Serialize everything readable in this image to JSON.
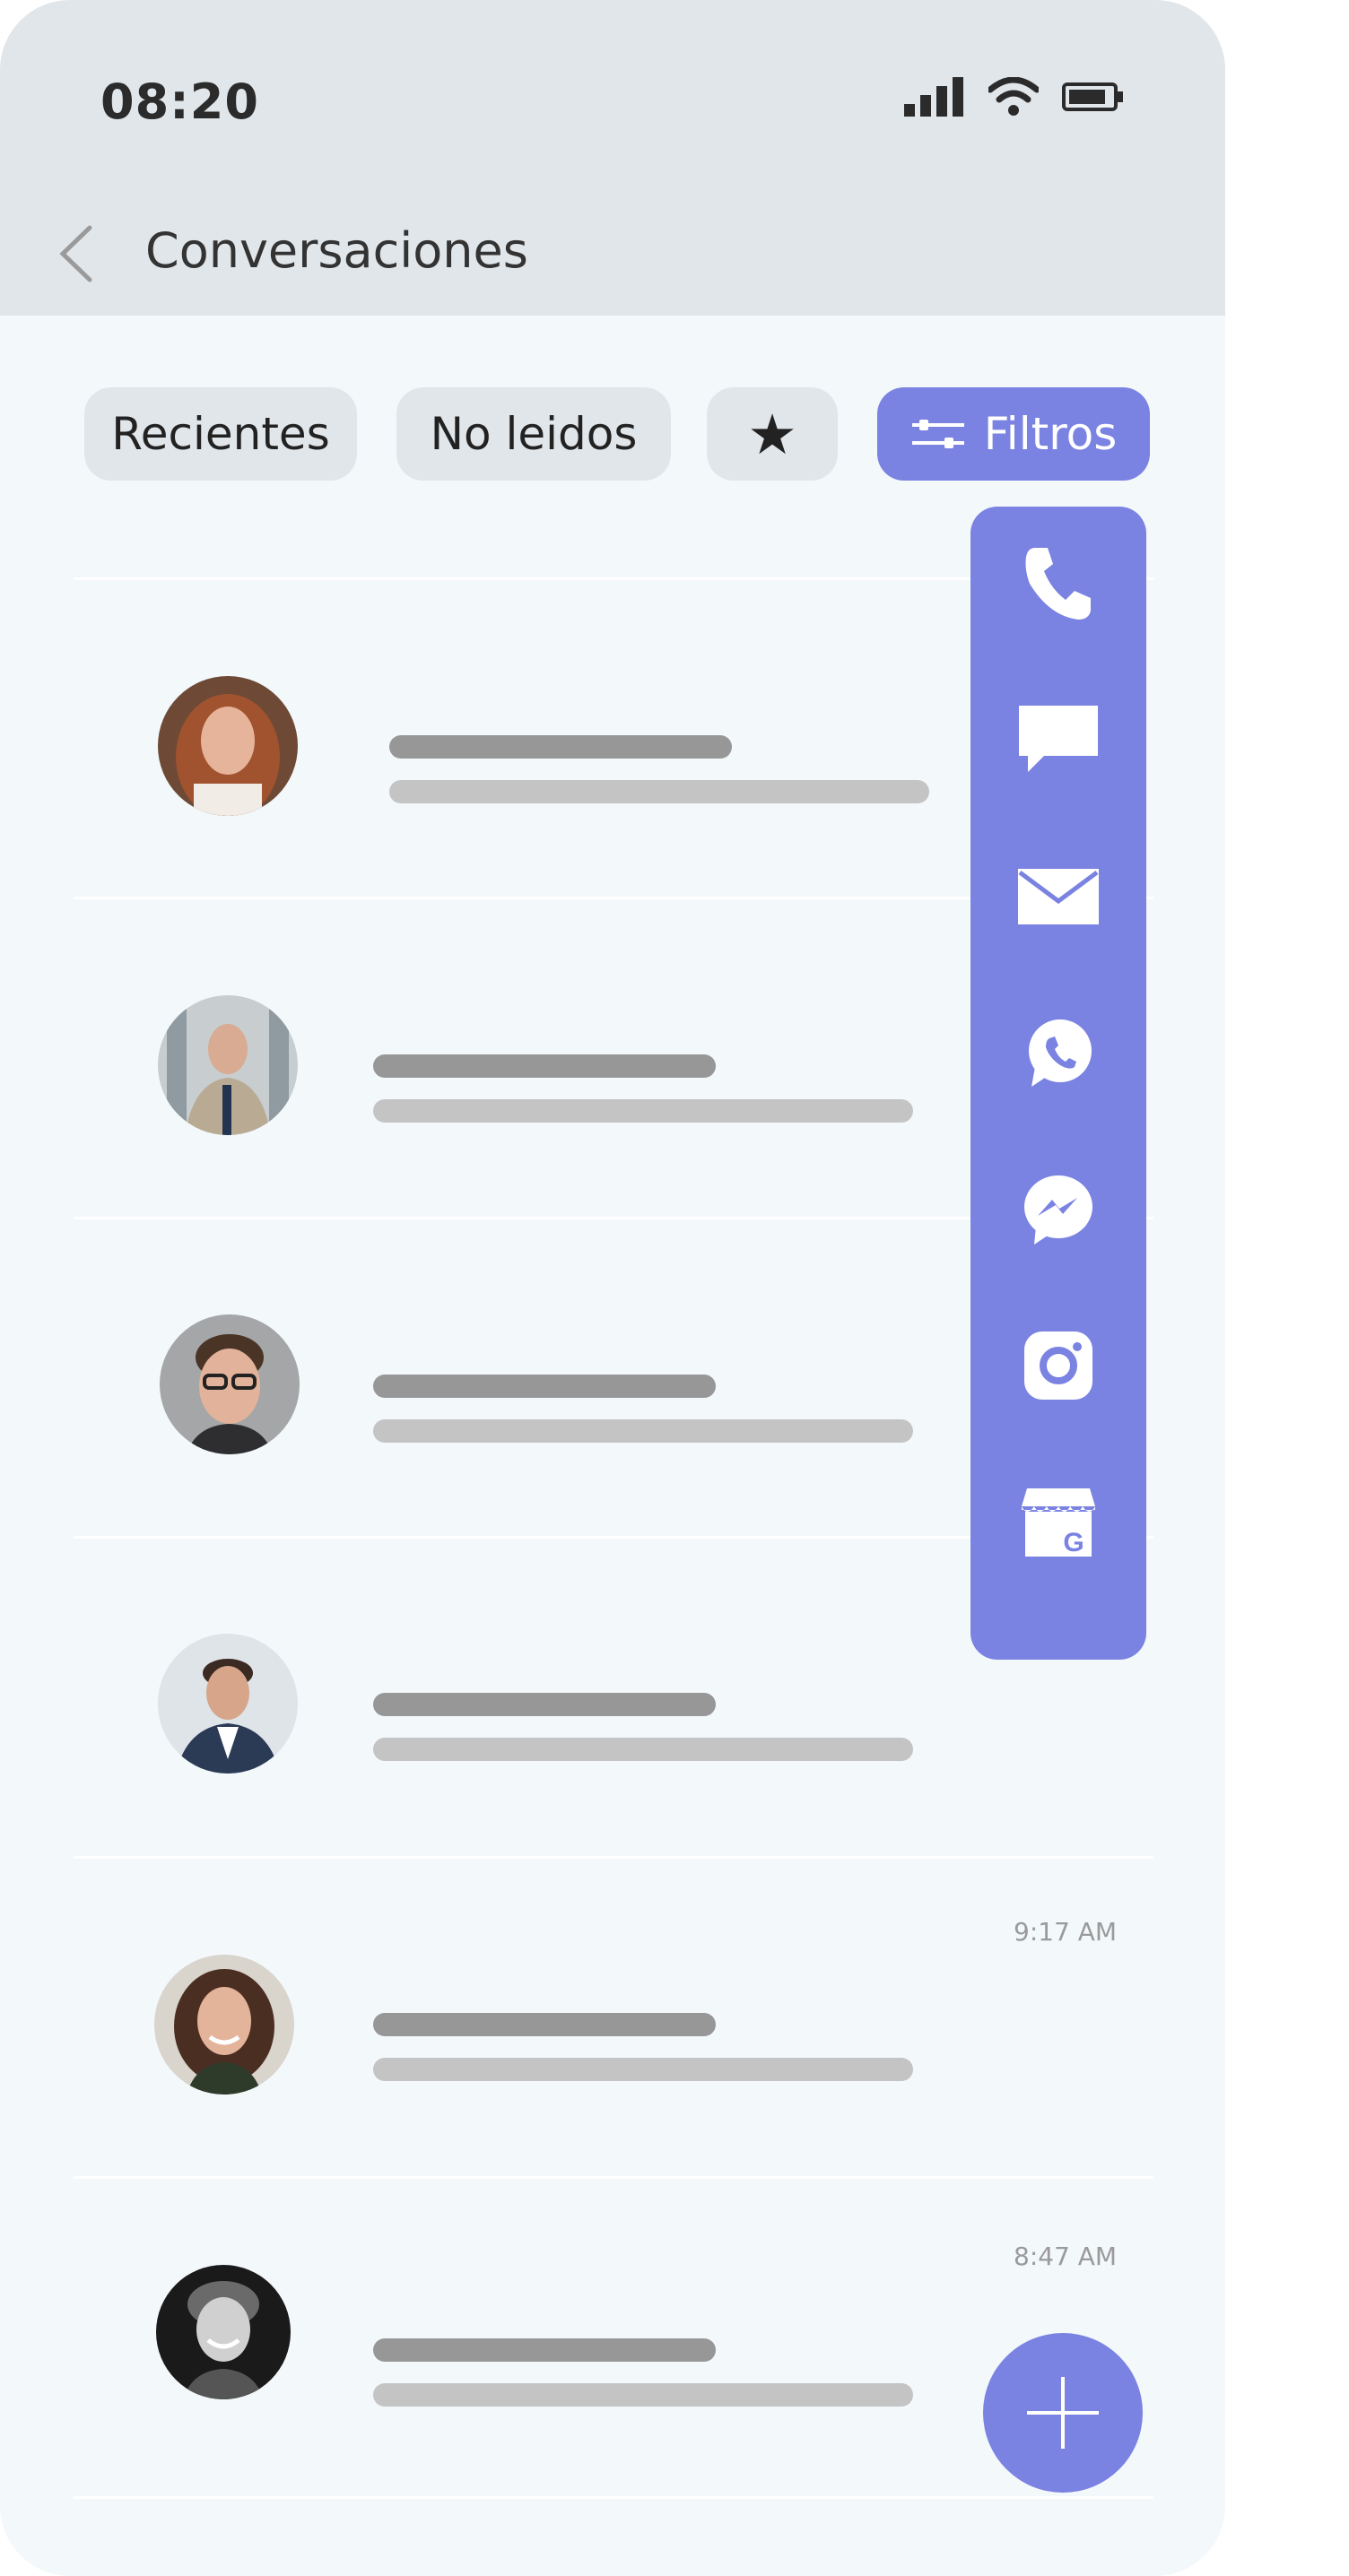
{
  "status_bar": {
    "time": "08:20"
  },
  "header": {
    "title": "Conversaciones"
  },
  "filters": {
    "recent_label": "Recientes",
    "unread_label": "No leidos",
    "starred_label": "★",
    "filters_label": "Filtros"
  },
  "channels": [
    {
      "icon": "phone-icon"
    },
    {
      "icon": "sms-chat-icon"
    },
    {
      "icon": "email-icon"
    },
    {
      "icon": "whatsapp-icon"
    },
    {
      "icon": "messenger-icon"
    },
    {
      "icon": "instagram-icon"
    },
    {
      "icon": "google-business-icon"
    }
  ],
  "conversations": [
    {
      "timestamp": ""
    },
    {
      "timestamp": ""
    },
    {
      "timestamp": ""
    },
    {
      "timestamp": ""
    },
    {
      "timestamp": "9:17 AM"
    },
    {
      "timestamp": "8:47 AM"
    }
  ],
  "colors": {
    "accent": "#7a82e2",
    "header_bg": "#e0e6ea",
    "list_bg": "#f3f8fb",
    "chip_bg": "#e1e6ea"
  }
}
